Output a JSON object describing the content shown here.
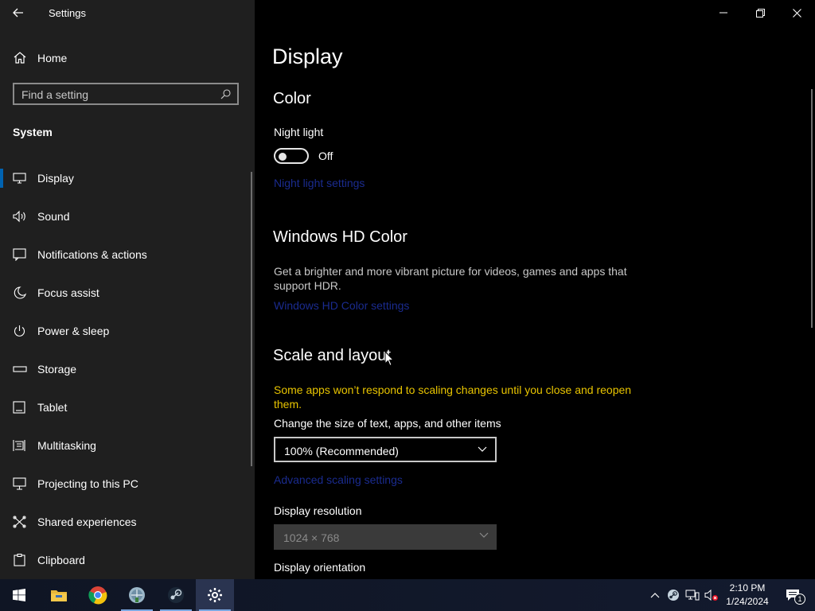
{
  "window": {
    "app_title": "Settings"
  },
  "sidebar": {
    "home_label": "Home",
    "search": {
      "placeholder": "Find a setting",
      "value": ""
    },
    "section_label": "System",
    "items": [
      {
        "label": "Display",
        "icon": "monitor-icon",
        "selected": true
      },
      {
        "label": "Sound",
        "icon": "speaker-icon"
      },
      {
        "label": "Notifications & actions",
        "icon": "notifications-icon"
      },
      {
        "label": "Focus assist",
        "icon": "moon-icon"
      },
      {
        "label": "Power & sleep",
        "icon": "power-icon"
      },
      {
        "label": "Storage",
        "icon": "storage-icon"
      },
      {
        "label": "Tablet",
        "icon": "tablet-icon"
      },
      {
        "label": "Multitasking",
        "icon": "multitasking-icon"
      },
      {
        "label": "Projecting to this PC",
        "icon": "projecting-icon"
      },
      {
        "label": "Shared experiences",
        "icon": "shared-experiences-icon"
      },
      {
        "label": "Clipboard",
        "icon": "clipboard-icon"
      }
    ]
  },
  "content": {
    "page_title": "Display",
    "color_section": {
      "heading": "Color",
      "night_light_label": "Night light",
      "night_light_state": "Off",
      "night_light_on": false,
      "night_light_settings_link": "Night light settings"
    },
    "hd_color_section": {
      "heading": "Windows HD Color",
      "description_line1": "Get a brighter and more vibrant picture for videos, games and apps that",
      "description_line2": "support HDR.",
      "settings_link": "Windows HD Color settings"
    },
    "scale_section": {
      "heading": "Scale and layout",
      "warning_line1": "Some apps won’t respond to scaling changes until you close and reopen",
      "warning_line2": "them.",
      "scale_label": "Change the size of text, apps, and other items",
      "scale_value": "100% (Recommended)",
      "advanced_link": "Advanced scaling settings",
      "resolution_label": "Display resolution",
      "resolution_value": "1024 × 768",
      "orientation_label": "Display orientation"
    }
  },
  "taskbar": {
    "apps": [
      {
        "name": "File Explorer",
        "icon": "file-explorer-icon"
      },
      {
        "name": "Google Chrome",
        "icon": "chrome-icon"
      },
      {
        "name": "Network app",
        "icon": "globe-app-icon"
      },
      {
        "name": "Steam",
        "icon": "steam-icon"
      },
      {
        "name": "Settings",
        "icon": "settings-gear-icon",
        "active": true
      }
    ],
    "clock_time": "2:10 PM",
    "clock_date": "1/24/2024",
    "notification_count": "1"
  },
  "colors": {
    "accent": "#0063b1",
    "link": "#1a2b8f",
    "warning": "#e8c400",
    "sidebar_bg": "#1f1f1f",
    "content_bg": "#000000"
  }
}
